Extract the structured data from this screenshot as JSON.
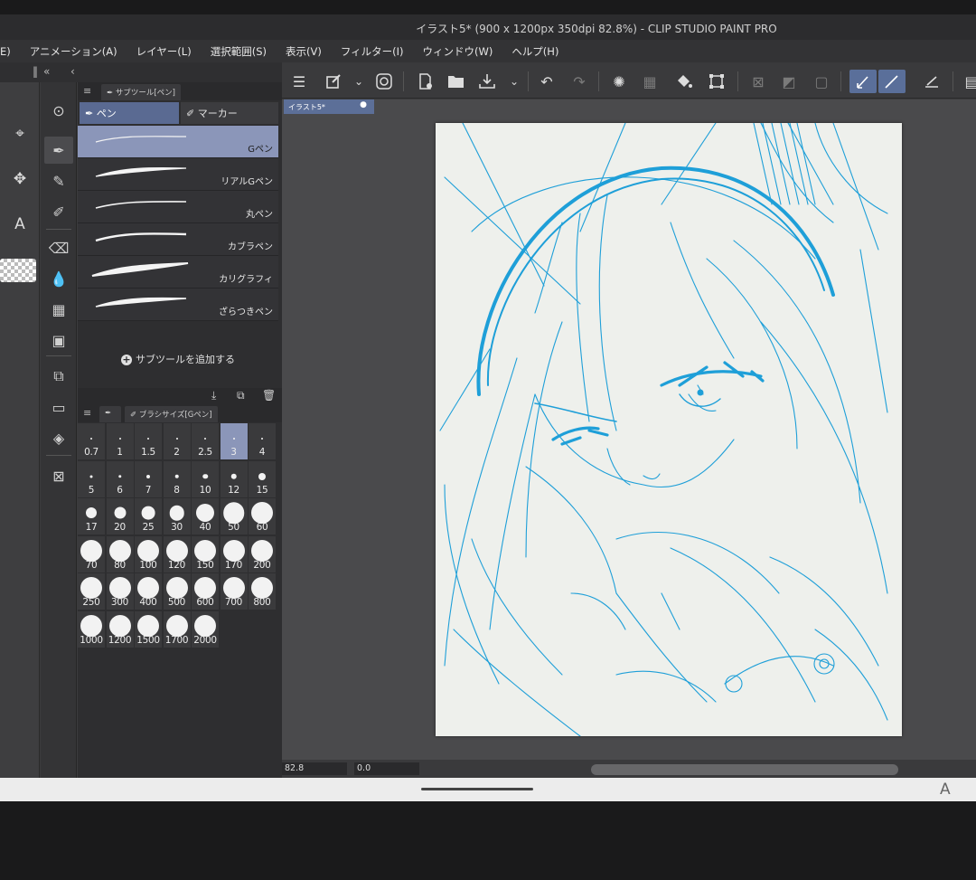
{
  "window": {
    "title": "イラスト5* (900 x 1200px 350dpi 82.8%)  - CLIP STUDIO PAINT PRO"
  },
  "menu": [
    "E)",
    "アニメーション(A)",
    "レイヤー(L)",
    "選択範囲(S)",
    "表示(V)",
    "フィルター(I)",
    "ウィンドウ(W)",
    "ヘルプ(H)"
  ],
  "panel_collapse": {
    "left": "«",
    "right": "‹"
  },
  "subtool_panel": {
    "header": "サブツール[ペン]",
    "groups": [
      "ペン",
      "マーカー"
    ],
    "active_group": "ペン",
    "brushes": [
      {
        "name": "Gペン",
        "selected": true
      },
      {
        "name": "リアルGペン",
        "selected": false
      },
      {
        "name": "丸ペン",
        "selected": false
      },
      {
        "name": "カブラペン",
        "selected": false
      },
      {
        "name": "カリグラフィ",
        "selected": false
      },
      {
        "name": "ざらつきペン",
        "selected": false
      }
    ],
    "add_label": "サブツールを追加する"
  },
  "brush_size_panel": {
    "header": "ブラシサイズ[Gペン]",
    "selected": "3",
    "sizes": [
      "0.7",
      "1",
      "1.5",
      "2",
      "2.5",
      "3",
      "4",
      "5",
      "6",
      "7",
      "8",
      "10",
      "12",
      "15",
      "17",
      "20",
      "25",
      "30",
      "40",
      "50",
      "60",
      "70",
      "80",
      "100",
      "120",
      "150",
      "170",
      "200",
      "250",
      "300",
      "400",
      "500",
      "600",
      "700",
      "800",
      "1000",
      "1200",
      "1500",
      "1700",
      "2000"
    ]
  },
  "document": {
    "tab_label": "イラスト5*",
    "zoom": "82.8",
    "rotation": "0.0"
  },
  "os": {
    "ime_indicator": "A"
  },
  "colors": {
    "accent": "#5a6a92",
    "selected_row": "#8b96b9",
    "line_art": "#1e9fd8",
    "paper": "#eef0ec"
  },
  "icons": [
    "menu-icon",
    "new-canvas-icon",
    "open-icon",
    "save-icon",
    "undo-icon",
    "redo-icon",
    "snap-icon",
    "fill-icon",
    "transform-icon",
    "pen-icon",
    "eraser-icon",
    "text-icon"
  ]
}
